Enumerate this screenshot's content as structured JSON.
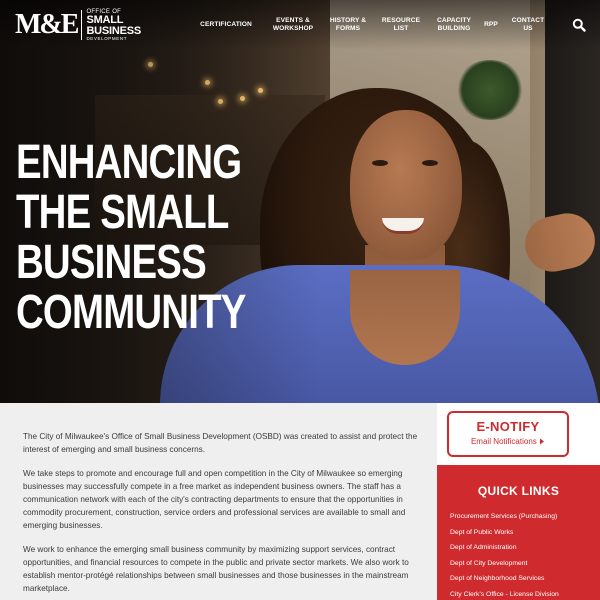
{
  "logo": {
    "mark": "M&E",
    "line1": "OFFICE OF",
    "line2": "SMALL",
    "line3": "BUSINESS",
    "line4": "DEVELOPMENT"
  },
  "nav": {
    "items": [
      {
        "label": "CERTIFICATION",
        "lines": [
          "CERTIFICATION"
        ]
      },
      {
        "label": "EVENTS & WORKSHOP",
        "lines": [
          "EVENTS &",
          "WORKSHOP"
        ]
      },
      {
        "label": "HISTORY & FORMS",
        "lines": [
          "HISTORY &",
          "FORMS"
        ]
      },
      {
        "label": "RESOURCE LIST",
        "lines": [
          "RESOURCE",
          "LIST"
        ]
      },
      {
        "label": "CAPACITY BUILDING",
        "lines": [
          "CAPACITY",
          "BUILDING"
        ]
      },
      {
        "label": "RPP",
        "lines": [
          "RPP"
        ]
      },
      {
        "label": "CONTACT US",
        "lines": [
          "CONTACT",
          "US"
        ]
      }
    ],
    "search_icon": "search-icon"
  },
  "hero": {
    "headline_lines": [
      "ENHANCING",
      "THE SMALL",
      "BUSINESS",
      "COMMUNITY"
    ]
  },
  "body": {
    "paragraphs": [
      "The City of Milwaukee's Office of Small Business Development (OSBD) was created to assist and protect the interest of emerging and small business concerns.",
      "We take steps to promote and encourage full and open competition in the City of Milwaukee so emerging businesses may successfully compete in a free market as independent business owners. The staff has a communication network with each of the city's contracting departments to ensure that the opportunities in commodity procurement, construction, service orders and professional services are available to small and emerging businesses.",
      "We work to enhance the emerging small business community by maximizing support services, contract opportunities, and financial resources to compete in the public and private sector markets. We also work to establish mentor-protégé relationships between small businesses and those businesses in the mainstream marketplace."
    ]
  },
  "sidebar": {
    "enotify_title": "E-NOTIFY",
    "enotify_sub": "Email Notifications",
    "enotify_icon": "caret-right-icon",
    "quick_links_title": "QUICK LINKS",
    "quick_links": [
      "Procurement Services (Purchasing)",
      "Dept of Public Works",
      "Dept of Administration",
      "Dept of City Development",
      "Dept of Neighborhood Services",
      "City Clerk's Office - License Division"
    ]
  },
  "colors": {
    "accent_red": "#cf2b2e",
    "body_bg": "#efefef",
    "text": "#3a3a3a"
  }
}
